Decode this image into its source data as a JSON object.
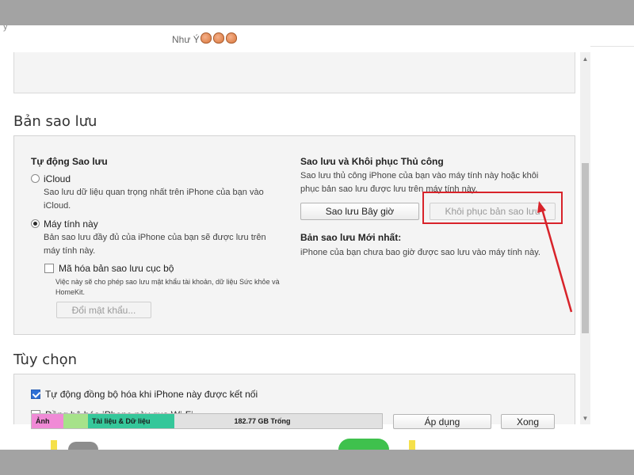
{
  "header": {
    "user_name": "Như Ý",
    "corner_glyph": "ỹ"
  },
  "backup": {
    "section_title": "Bản sao lưu",
    "auto": {
      "heading": "Tự động Sao lưu",
      "icloud_label": "iCloud",
      "icloud_desc_1": "Sao lưu dữ liệu quan trọng nhất trên iPhone của bạn vào",
      "icloud_desc_2": "iCloud.",
      "computer_label": "Máy tính này",
      "computer_desc_1": "Bản sao lưu đầy đủ của iPhone của bạn sẽ được lưu trên",
      "computer_desc_2": "máy tính này.",
      "encrypt_label": "Mã hóa bản sao lưu cục bộ",
      "encrypt_desc_1": "Việc này sẽ cho phép sao lưu mật khẩu tài khoản, dữ liệu Sức khỏe và",
      "encrypt_desc_2": "HomeKit.",
      "change_password_button": "Đổi mật khẩu..."
    },
    "manual": {
      "heading": "Sao lưu và Khôi phục Thủ công",
      "desc_1": "Sao lưu thủ công iPhone của bạn vào máy tính này hoặc khôi",
      "desc_2": "phục bản sao lưu được lưu trên máy tính này.",
      "backup_now_button": "Sao lưu Bây giờ",
      "restore_button": "Khôi phục bản sao lưu",
      "latest_heading": "Bản sao lưu Mới nhất:",
      "latest_desc": "iPhone của bạn chưa bao giờ được sao lưu vào máy tính này."
    }
  },
  "options": {
    "section_title": "Tùy chọn",
    "auto_sync_label": "Tự động đồng bộ hóa khi iPhone này được kết nối",
    "wifi_sync_label": "Đồng bộ hóa iPhone này qua Wi-Fi",
    "auto_sync_checked": true,
    "wifi_sync_checked": false
  },
  "storage": {
    "photos_label": "Ảnh",
    "docs_label": "Tài liệu & Dữ liệu",
    "free_label": "182.77 GB Trống",
    "colors": {
      "photos": "#f08ad6",
      "other": "#a6e28a",
      "docs": "#35c79a",
      "free": "#e1e1e1"
    }
  },
  "footer": {
    "apply_button": "Áp dụng",
    "done_button": "Xong"
  },
  "annotation": {
    "highlight_color": "#d8232a"
  }
}
